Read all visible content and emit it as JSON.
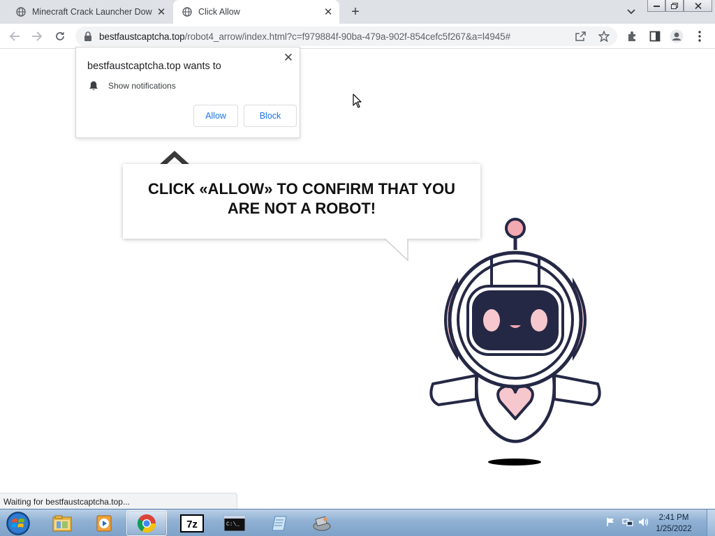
{
  "tabs": [
    {
      "title": "Minecraft Crack Launcher Downl",
      "active": false
    },
    {
      "title": "Click Allow",
      "active": true
    }
  ],
  "address_bar": {
    "domain": "bestfaustcaptcha.top",
    "path": "/robot4_arrow/index.html?c=f979884f-90ba-479a-902f-854cefc5f267&a=l4945#"
  },
  "permission_prompt": {
    "title": "bestfaustcaptcha.top wants to",
    "permission": "Show notifications",
    "allow_label": "Allow",
    "block_label": "Block"
  },
  "page": {
    "headline": "CLICK «ALLOW» TO CONFIRM THAT YOU ARE NOT A ROBOT!"
  },
  "status_bar": {
    "text": "Waiting for bestfaustcaptcha.top..."
  },
  "taskbar": {
    "apps": [
      "windows-explorer",
      "media-player",
      "chrome",
      "7-zip",
      "command-prompt",
      "notepad",
      "network-app"
    ],
    "active_app": "chrome",
    "time": "2:41 PM",
    "date": "1/25/2022"
  },
  "colors": {
    "tabstrip_bg": "#dee1e6",
    "link_blue": "#1a73e8",
    "robot_outline": "#252845",
    "robot_pink": "#f6c7cd",
    "robot_accent": "#f3a9b1"
  }
}
